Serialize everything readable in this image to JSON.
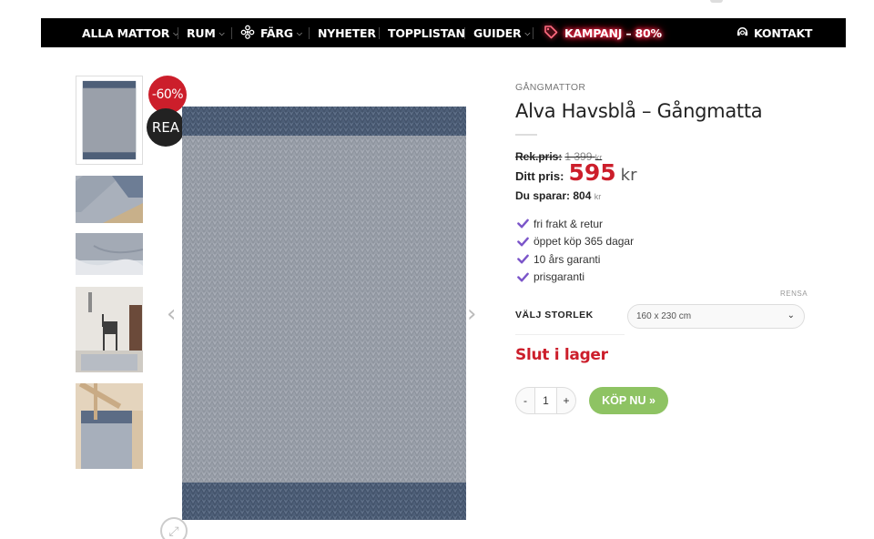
{
  "nav": {
    "items": [
      {
        "label": "ALLA MATTOR",
        "has_dropdown": true
      },
      {
        "label": "RUM",
        "has_dropdown": true
      },
      {
        "label": "FÄRG",
        "has_dropdown": true
      },
      {
        "label": "NYHETER",
        "has_dropdown": false
      },
      {
        "label": "TOPPLISTAN",
        "has_dropdown": false
      },
      {
        "label": "GUIDER",
        "has_dropdown": true
      },
      {
        "label": "KAMPANJ – 80%",
        "has_dropdown": false
      }
    ],
    "contact_label": "KONTAKT"
  },
  "badges": {
    "sale": "-60%",
    "rea": "REA"
  },
  "product": {
    "category": "GÅNGMATTOR",
    "title": "Alva Havsblå – Gångmatta",
    "rek_label": "Rek.pris:",
    "rek_value": "1 399",
    "rek_currency": "kr",
    "price_label": "Ditt pris:",
    "price_value": "595",
    "price_currency": "kr",
    "save_label": "Du sparar:",
    "save_value": "804",
    "save_currency": "kr",
    "usps": [
      "fri frakt & retur",
      "öppet köp 365 dagar",
      "10 års garanti",
      "prisgaranti"
    ],
    "size_label": "VÄLJ STORLEK",
    "clear_label": "RENSA",
    "size_selected": "160 x 230 cm",
    "stock_status": "Slut i lager",
    "quantity": "1",
    "qty_minus": "-",
    "qty_plus": "+",
    "buy_label": "KÖP NU »"
  },
  "colors": {
    "accent_red": "#cc1e2b",
    "buy_green": "#8ec363",
    "check_purple": "#7b55c9",
    "nav_bg": "#000000",
    "rug_border": "#4e5f78",
    "rug_body": "#9aa0aa"
  }
}
